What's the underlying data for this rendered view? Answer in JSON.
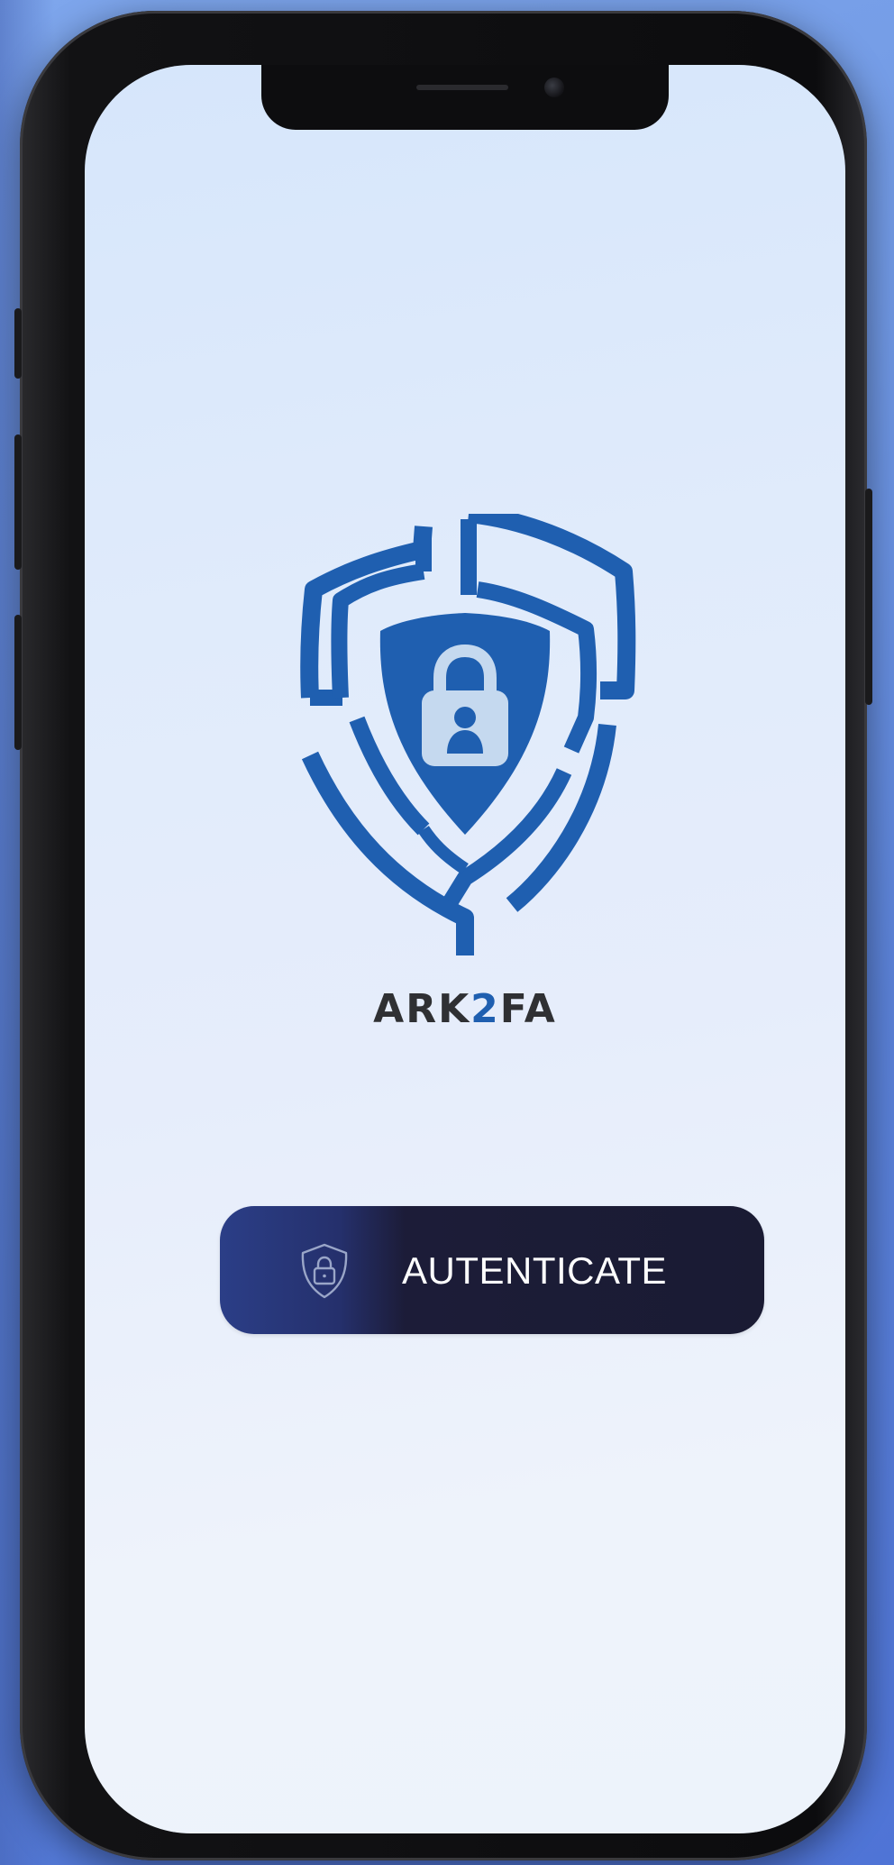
{
  "app": {
    "brand_prefix": "ARK",
    "brand_number": "2",
    "brand_suffix": "FA"
  },
  "actions": {
    "authenticate_label": "AUTENTICATE"
  },
  "icons": {
    "logo": "shield-lock-logo-icon",
    "button_icon": "shield-lock-icon"
  },
  "colors": {
    "brand_blue": "#1f5fb0",
    "button_dark": "#1a1b33",
    "button_accent": "#2b3e87",
    "text_dark": "#2f3033"
  }
}
